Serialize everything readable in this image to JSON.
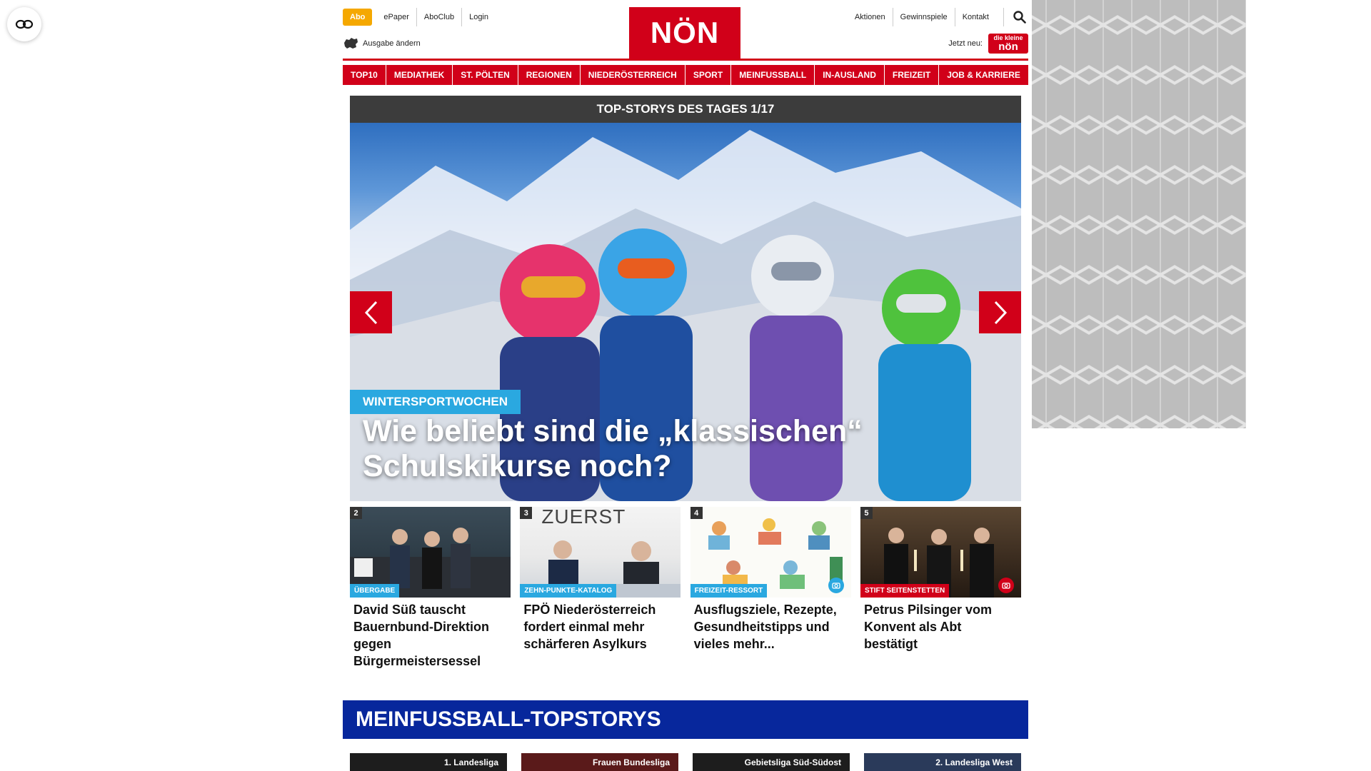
{
  "header": {
    "abo_label": "Abo",
    "left_links": [
      "ePaper",
      "AboClub",
      "Login"
    ],
    "ausgabe_label": "Ausgabe ändern",
    "logo_text": "NÖN",
    "right_links": [
      "Aktionen",
      "Gewinnspiele",
      "Kontakt"
    ],
    "jetzt_label": "Jetzt neu:",
    "kinder_small": "die kleine",
    "kinder_big": "nön"
  },
  "nav": [
    "TOP10",
    "MEDIATHEK",
    "ST. PÖLTEN",
    "REGIONEN",
    "NIEDERÖSTERREICH",
    "SPORT",
    "MEINFUSSBALL",
    "IN-AUSLAND",
    "FREIZEIT",
    "JOB & KARRIERE"
  ],
  "stage": {
    "title": "TOP-STORYS DES TAGES 1/17",
    "tag": "WINTERSPORTWOCHEN",
    "headline": "Wie beliebt sind die „klassischen“ Schulskikurse noch?"
  },
  "cards": [
    {
      "num": "2",
      "badge": "ÜBERGABE",
      "title": "David Süß tauscht Bauernbund-Direktion gegen Bürgermeistersessel"
    },
    {
      "num": "3",
      "badge": "ZEHN-PUNKTE-KATALOG",
      "title": "FPÖ Niederösterreich fordert einmal mehr schärferen Asylkurs",
      "img_text": "ZUERST"
    },
    {
      "num": "4",
      "badge": "FREIZEIT-RESSORT",
      "title": "Ausflugsziele, Rezepte, Gesundheitstipps und vieles mehr..."
    },
    {
      "num": "5",
      "badge": "STIFT SEITENSTETTEN",
      "title": "Petrus Pilsinger vom Konvent als Abt bestätigt"
    }
  ],
  "meinfussball": {
    "title": "MEINFUSSBALL-TOPSTORYS",
    "leagues": [
      "1. Landesliga",
      "Frauen Bundesliga",
      "Gebietsliga Süd-Südost",
      "2. Landesliga West"
    ]
  },
  "colors": {
    "brand_red": "#d10019",
    "abo_orange": "#f5a800",
    "tag_blue": "#2aa8e0",
    "fussball_blue": "#07279c"
  }
}
